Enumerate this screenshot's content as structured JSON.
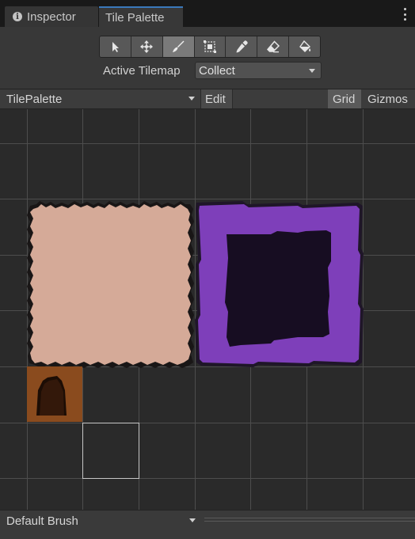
{
  "tabs": [
    {
      "label": "Inspector",
      "icon": "info-icon",
      "active": false
    },
    {
      "label": "Tile Palette",
      "active": true
    }
  ],
  "tools": [
    {
      "name": "select-tool",
      "active": false
    },
    {
      "name": "move-tool",
      "active": false
    },
    {
      "name": "paint-brush-tool",
      "active": true
    },
    {
      "name": "box-fill-tool",
      "active": false
    },
    {
      "name": "picker-tool",
      "active": false
    },
    {
      "name": "eraser-tool",
      "active": false
    },
    {
      "name": "flood-fill-tool",
      "active": false
    }
  ],
  "active_tilemap": {
    "label": "Active Tilemap",
    "value": "Collect"
  },
  "palette_bar": {
    "palette_name": "TilePalette",
    "edit_label": "Edit",
    "grid_label": "Grid",
    "gizmos_label": "Gizmos"
  },
  "tiles": [
    {
      "name": "pink-platform-tile",
      "color": "#d5aa98"
    },
    {
      "name": "purple-frame-tile",
      "color": "#7e3fba",
      "inner_color": "#170d22"
    },
    {
      "name": "door-tile",
      "color": "#8a4b1e",
      "inner_color": "#33180a"
    }
  ],
  "brush": {
    "label": "Default Brush"
  },
  "colors": {
    "accent": "#3a79bb",
    "background": "#282828",
    "grid": "#4d4d4d"
  }
}
